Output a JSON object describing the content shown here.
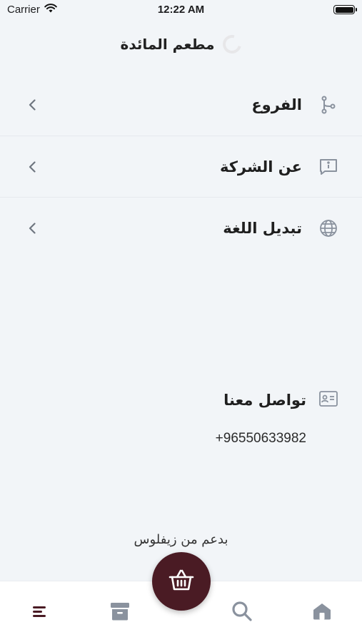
{
  "status": {
    "carrier": "Carrier",
    "time": "12:22 AM"
  },
  "header": {
    "title": "مطعم المائدة"
  },
  "menu": [
    {
      "label": "الفروع",
      "icon": "branches-icon"
    },
    {
      "label": "عن الشركة",
      "icon": "info-message-icon"
    },
    {
      "label": "تبديل اللغة",
      "icon": "globe-icon"
    }
  ],
  "contact": {
    "title": "تواصل معنا",
    "phone": "+96550633982"
  },
  "footer": {
    "powered_by": "بدعم من زيفلوس"
  },
  "tabs": [
    "menu-icon",
    "box-icon",
    "basket-icon",
    "search-icon",
    "home-icon"
  ],
  "colors": {
    "accent": "#4a1b24",
    "background": "#f2f5f8",
    "icon_gray": "#8a929e"
  }
}
